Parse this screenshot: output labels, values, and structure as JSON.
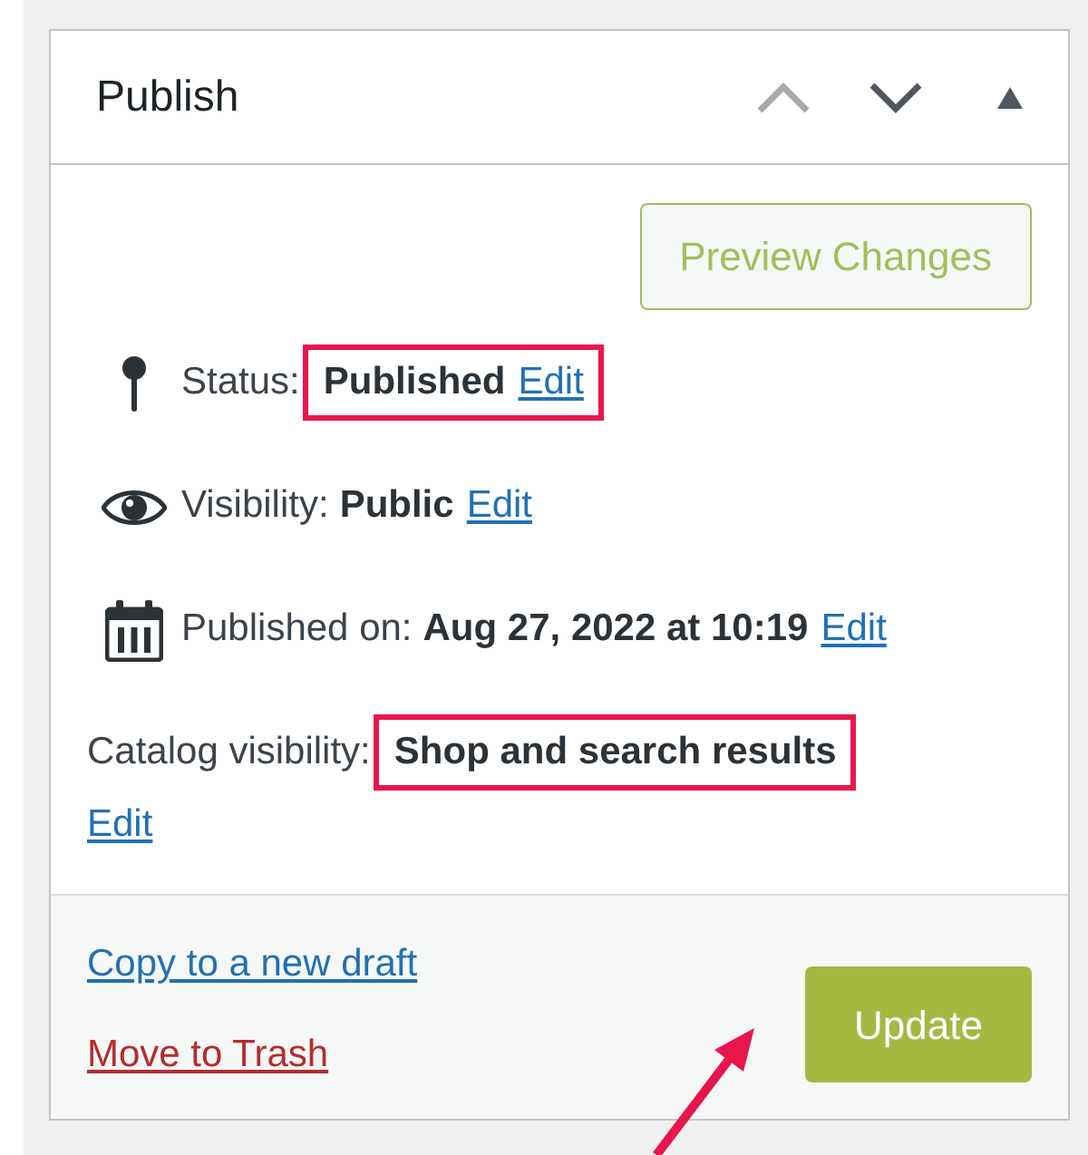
{
  "panel": {
    "title": "Publish",
    "preview_button": "Preview Changes",
    "rows": [
      {
        "kind": "status",
        "label": "Status:",
        "value": "Published",
        "link": "Edit",
        "highlighted": true
      },
      {
        "kind": "visibility",
        "label": "Visibility:",
        "value": "Public",
        "link": "Edit",
        "highlighted": false
      },
      {
        "kind": "date",
        "label": "Published on:",
        "value": "Aug 27, 2022 at 10:19",
        "link": "Edit",
        "highlighted": false
      },
      {
        "kind": "catalog",
        "label": "Catalog visibility:",
        "value": "Shop and search results",
        "link": "Edit",
        "highlighted": true
      }
    ],
    "footer": {
      "links": [
        {
          "kind": "normal",
          "label": "Copy to a new draft"
        },
        {
          "kind": "danger",
          "label": "Move to Trash"
        }
      ],
      "primary_button": "Update"
    }
  }
}
